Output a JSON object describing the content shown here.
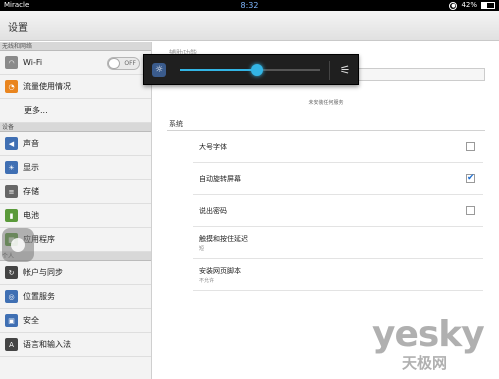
{
  "statusbar": {
    "carrier": "Miracle",
    "time": "8:32",
    "battery": "42%",
    "battery_level": 0.42
  },
  "titlebar": {
    "title": "设置"
  },
  "sidebar": {
    "sections": [
      {
        "header": "无线和网络",
        "items": [
          {
            "label": "Wi-Fi",
            "icon": "wifi-icon",
            "toggle": "OFF"
          },
          {
            "label": "流量使用情况",
            "icon": "data-usage-icon"
          },
          {
            "label": "更多...",
            "icon": ""
          }
        ]
      },
      {
        "header": "设备",
        "items": [
          {
            "label": "声音",
            "icon": "speaker-icon"
          },
          {
            "label": "显示",
            "icon": "display-icon"
          },
          {
            "label": "存储",
            "icon": "storage-icon"
          },
          {
            "label": "电池",
            "icon": "battery-icon"
          },
          {
            "label": "应用程序",
            "icon": "apps-icon"
          }
        ]
      },
      {
        "header": "个人",
        "items": [
          {
            "label": "帐户与同步",
            "icon": "sync-icon"
          },
          {
            "label": "位置服务",
            "icon": "location-icon"
          },
          {
            "label": "安全",
            "icon": "lock-icon"
          },
          {
            "label": "语言和输入法",
            "icon": "keyboard-icon"
          }
        ]
      }
    ]
  },
  "content": {
    "header_partial": "辅助功能",
    "no_service": "未安装任何服务",
    "system_label": "系统",
    "rows": [
      {
        "label": "大号字体",
        "checked": false
      },
      {
        "label": "自动旋转屏幕",
        "checked": true
      },
      {
        "label": "说出密码",
        "checked": false
      },
      {
        "label": "触摸和按住延迟",
        "sub": "短"
      },
      {
        "label": "安装网页脚本",
        "sub": "不允许"
      }
    ]
  },
  "brightness_popup": {
    "level": 0.55
  },
  "watermark": {
    "line1": "yesky",
    "line2": "天极网"
  }
}
